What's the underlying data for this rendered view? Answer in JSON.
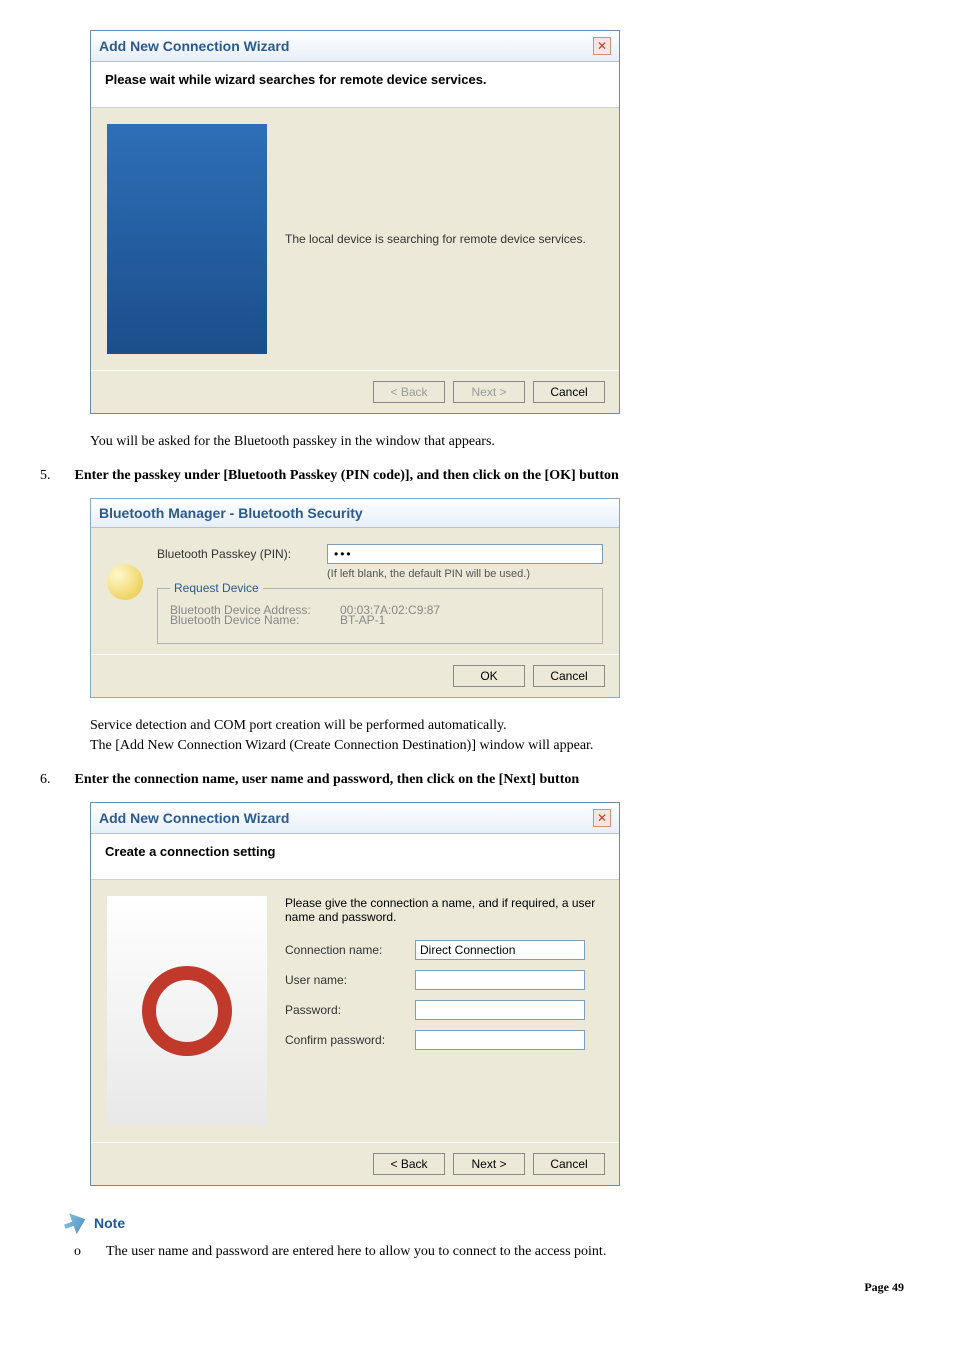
{
  "wizard1": {
    "title": "Add New Connection Wizard",
    "subheader": "Please wait while wizard searches for remote device services.",
    "body": "The local device is searching for remote device services.",
    "back": "< Back",
    "next": "Next >",
    "cancel": "Cancel"
  },
  "p1": "You will be asked for the Bluetooth passkey in the window that appears.",
  "step5_num": "5.",
  "step5_text": "Enter the passkey under [Bluetooth Passkey (PIN code)], and then click on the [OK] button",
  "security": {
    "title": "Bluetooth Manager - Bluetooth Security",
    "pin_label": "Bluetooth Passkey (PIN):",
    "pin_value": "•••",
    "hint": "(If left blank, the default PIN will be used.)",
    "rd_legend": "Request Device",
    "addr_label": "Bluetooth Device Address:",
    "addr_value": "00:03:7A:02:C9:87",
    "name_label": "Bluetooth Device Name:",
    "name_value": "BT-AP-1",
    "ok": "OK",
    "cancel": "Cancel"
  },
  "p2a": "Service detection and COM port creation will be performed automatically.",
  "p2b": "The [Add New Connection Wizard (Create Connection Destination)] window will appear.",
  "step6_num": "6.",
  "step6_text": "Enter the connection name, user name and password, then click on the [Next] button",
  "wizard2": {
    "title": "Add New Connection Wizard",
    "subheader": "Create a connection setting",
    "prompt": "Please give the connection a name, and if required, a user name and password.",
    "conn_label": "Connection name:",
    "conn_value": "Direct Connection",
    "user_label": "User name:",
    "user_value": "",
    "pass_label": "Password:",
    "pass_value": "",
    "confirm_label": "Confirm password:",
    "confirm_value": "",
    "back": "< Back",
    "next": "Next >",
    "cancel": "Cancel"
  },
  "note_label": "Note",
  "note_bullet": "o",
  "note_text": "The user name and password are entered here to allow you to connect to the access point.",
  "page_num": "Page 49"
}
